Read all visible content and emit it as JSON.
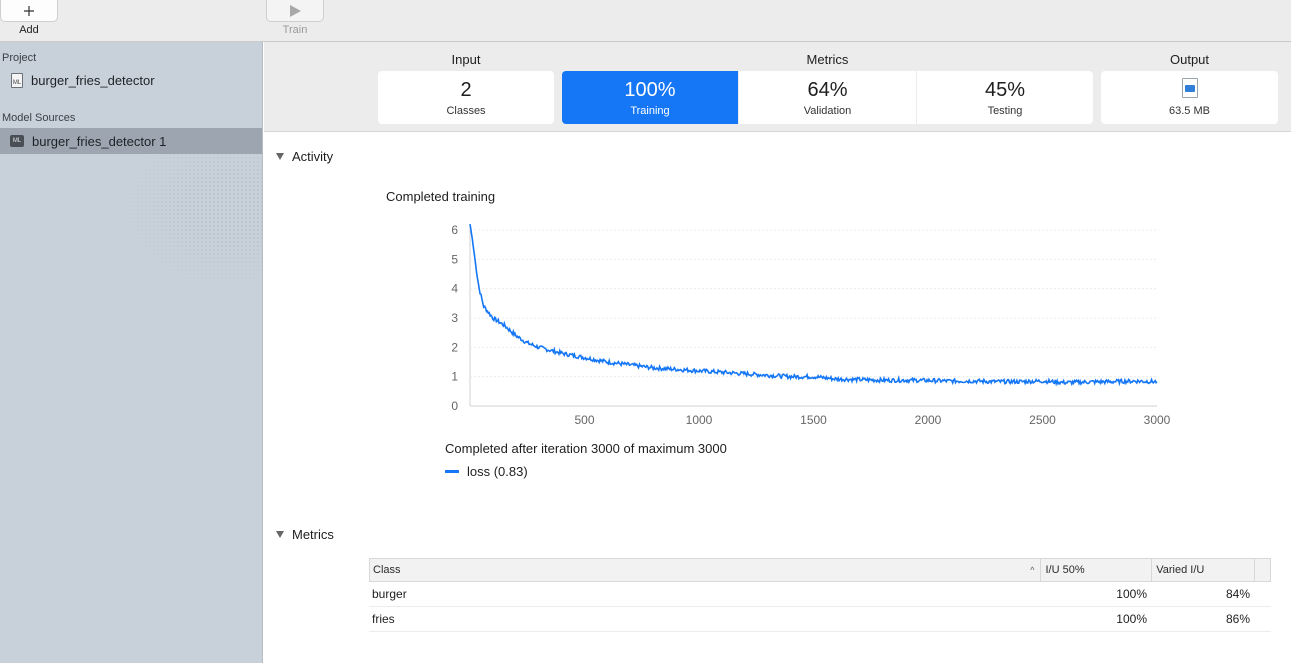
{
  "toolbar": {
    "add_icon": "plus-icon",
    "add_label": "Add",
    "train_icon": "play-icon",
    "train_label": "Train"
  },
  "sidebar": {
    "project_heading": "Project",
    "project_item": "burger_fries_detector",
    "project_icon": "ml-document-icon",
    "sources_heading": "Model Sources",
    "source_item": "burger_fries_detector 1",
    "source_icon": "ml-model-icon"
  },
  "summary": {
    "input_heading": "Input",
    "metrics_heading": "Metrics",
    "output_heading": "Output",
    "classes": {
      "value": "2",
      "label": "Classes"
    },
    "training": {
      "value": "100%",
      "label": "Training"
    },
    "validation": {
      "value": "64%",
      "label": "Validation"
    },
    "testing": {
      "value": "45%",
      "label": "Testing"
    },
    "output": {
      "icon": "mlmodel-file-icon",
      "size": "63.5 MB"
    },
    "active_color": "#1577f5"
  },
  "activity": {
    "section_title": "Activity",
    "status": "Completed training",
    "caption": "Completed after iteration 3000 of maximum 3000",
    "legend": "loss (0.83)"
  },
  "chart_data": {
    "type": "line",
    "title": "",
    "xlabel": "",
    "ylabel": "",
    "xlim": [
      0,
      3000
    ],
    "ylim": [
      0,
      6
    ],
    "xticks": [
      500,
      1000,
      1500,
      2000,
      2500,
      3000
    ],
    "yticks": [
      0,
      1,
      2,
      3,
      4,
      5,
      6
    ],
    "grid": true,
    "series": [
      {
        "name": "loss (0.83)",
        "color": "#1577f5",
        "x": [
          0,
          10,
          25,
          40,
          60,
          80,
          100,
          150,
          200,
          250,
          300,
          400,
          500,
          600,
          700,
          800,
          900,
          1000,
          1100,
          1200,
          1300,
          1400,
          1500,
          1600,
          1700,
          1800,
          1900,
          2000,
          2100,
          2200,
          2300,
          2400,
          2500,
          2600,
          2700,
          2800,
          2900,
          3000
        ],
        "y": [
          6.2,
          5.7,
          4.8,
          4.0,
          3.4,
          3.2,
          3.0,
          2.75,
          2.4,
          2.15,
          2.0,
          1.8,
          1.65,
          1.5,
          1.4,
          1.3,
          1.25,
          1.2,
          1.15,
          1.1,
          1.05,
          1.0,
          1.0,
          0.92,
          0.9,
          0.88,
          0.88,
          0.87,
          0.85,
          0.85,
          0.83,
          0.83,
          0.85,
          0.8,
          0.82,
          0.83,
          0.85,
          0.83
        ]
      }
    ]
  },
  "metrics": {
    "section_title": "Metrics",
    "columns": [
      "Class",
      "I/U 50%",
      "Varied I/U"
    ],
    "sort_icon": "chevron-up-icon",
    "rows": [
      {
        "class": "burger",
        "iu50": "100%",
        "varied": "84%"
      },
      {
        "class": "fries",
        "iu50": "100%",
        "varied": "86%"
      }
    ]
  }
}
